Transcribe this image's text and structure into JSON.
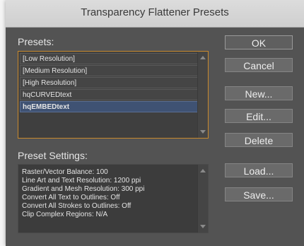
{
  "window": {
    "title": "Transparency Flattener Presets"
  },
  "presets": {
    "label": "Presets:",
    "items": [
      {
        "label": "[Low Resolution]",
        "selected": false
      },
      {
        "label": "[Medium Resolution]",
        "selected": false
      },
      {
        "label": "[High Resolution]",
        "selected": false
      },
      {
        "label": "hqCURVEDtext",
        "selected": false
      },
      {
        "label": "hqEMBEDtext",
        "selected": true
      }
    ]
  },
  "settings": {
    "label": "Preset Settings:",
    "lines": [
      "Raster/Vector Balance: 100",
      "Line Art and Text Resolution: 1200 ppi",
      "Gradient and Mesh Resolution: 300 ppi",
      "Convert All Text to Outlines: Off",
      "Convert All Strokes to Outlines: Off",
      "Clip Complex Regions: N/A"
    ]
  },
  "buttons": {
    "ok": "OK",
    "cancel": "Cancel",
    "new": "New...",
    "edit": "Edit...",
    "delete": "Delete",
    "load": "Load...",
    "save": "Save..."
  },
  "colors": {
    "dialog_bg": "#535353",
    "list_focus_border": "#c98a2d",
    "selection": "#3f5273"
  }
}
